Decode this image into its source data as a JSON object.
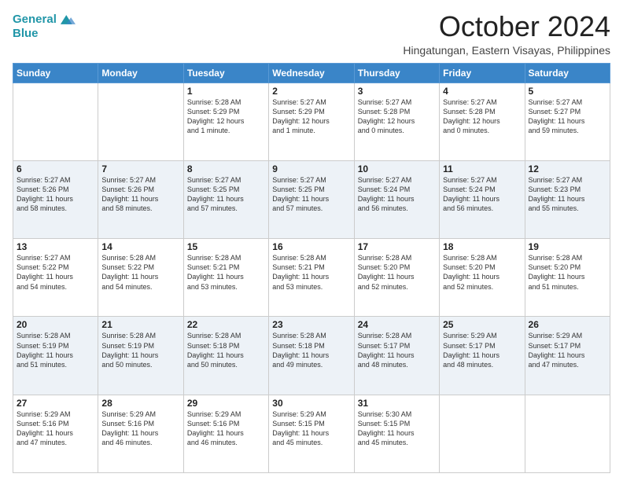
{
  "header": {
    "logo_line1": "General",
    "logo_line2": "Blue",
    "month_title": "October 2024",
    "location": "Hingatungan, Eastern Visayas, Philippines"
  },
  "days_of_week": [
    "Sunday",
    "Monday",
    "Tuesday",
    "Wednesday",
    "Thursday",
    "Friday",
    "Saturday"
  ],
  "weeks": [
    [
      {
        "day": "",
        "text": ""
      },
      {
        "day": "",
        "text": ""
      },
      {
        "day": "1",
        "text": "Sunrise: 5:28 AM\nSunset: 5:29 PM\nDaylight: 12 hours\nand 1 minute."
      },
      {
        "day": "2",
        "text": "Sunrise: 5:27 AM\nSunset: 5:29 PM\nDaylight: 12 hours\nand 1 minute."
      },
      {
        "day": "3",
        "text": "Sunrise: 5:27 AM\nSunset: 5:28 PM\nDaylight: 12 hours\nand 0 minutes."
      },
      {
        "day": "4",
        "text": "Sunrise: 5:27 AM\nSunset: 5:28 PM\nDaylight: 12 hours\nand 0 minutes."
      },
      {
        "day": "5",
        "text": "Sunrise: 5:27 AM\nSunset: 5:27 PM\nDaylight: 11 hours\nand 59 minutes."
      }
    ],
    [
      {
        "day": "6",
        "text": "Sunrise: 5:27 AM\nSunset: 5:26 PM\nDaylight: 11 hours\nand 58 minutes."
      },
      {
        "day": "7",
        "text": "Sunrise: 5:27 AM\nSunset: 5:26 PM\nDaylight: 11 hours\nand 58 minutes."
      },
      {
        "day": "8",
        "text": "Sunrise: 5:27 AM\nSunset: 5:25 PM\nDaylight: 11 hours\nand 57 minutes."
      },
      {
        "day": "9",
        "text": "Sunrise: 5:27 AM\nSunset: 5:25 PM\nDaylight: 11 hours\nand 57 minutes."
      },
      {
        "day": "10",
        "text": "Sunrise: 5:27 AM\nSunset: 5:24 PM\nDaylight: 11 hours\nand 56 minutes."
      },
      {
        "day": "11",
        "text": "Sunrise: 5:27 AM\nSunset: 5:24 PM\nDaylight: 11 hours\nand 56 minutes."
      },
      {
        "day": "12",
        "text": "Sunrise: 5:27 AM\nSunset: 5:23 PM\nDaylight: 11 hours\nand 55 minutes."
      }
    ],
    [
      {
        "day": "13",
        "text": "Sunrise: 5:27 AM\nSunset: 5:22 PM\nDaylight: 11 hours\nand 54 minutes."
      },
      {
        "day": "14",
        "text": "Sunrise: 5:28 AM\nSunset: 5:22 PM\nDaylight: 11 hours\nand 54 minutes."
      },
      {
        "day": "15",
        "text": "Sunrise: 5:28 AM\nSunset: 5:21 PM\nDaylight: 11 hours\nand 53 minutes."
      },
      {
        "day": "16",
        "text": "Sunrise: 5:28 AM\nSunset: 5:21 PM\nDaylight: 11 hours\nand 53 minutes."
      },
      {
        "day": "17",
        "text": "Sunrise: 5:28 AM\nSunset: 5:20 PM\nDaylight: 11 hours\nand 52 minutes."
      },
      {
        "day": "18",
        "text": "Sunrise: 5:28 AM\nSunset: 5:20 PM\nDaylight: 11 hours\nand 52 minutes."
      },
      {
        "day": "19",
        "text": "Sunrise: 5:28 AM\nSunset: 5:20 PM\nDaylight: 11 hours\nand 51 minutes."
      }
    ],
    [
      {
        "day": "20",
        "text": "Sunrise: 5:28 AM\nSunset: 5:19 PM\nDaylight: 11 hours\nand 51 minutes."
      },
      {
        "day": "21",
        "text": "Sunrise: 5:28 AM\nSunset: 5:19 PM\nDaylight: 11 hours\nand 50 minutes."
      },
      {
        "day": "22",
        "text": "Sunrise: 5:28 AM\nSunset: 5:18 PM\nDaylight: 11 hours\nand 50 minutes."
      },
      {
        "day": "23",
        "text": "Sunrise: 5:28 AM\nSunset: 5:18 PM\nDaylight: 11 hours\nand 49 minutes."
      },
      {
        "day": "24",
        "text": "Sunrise: 5:28 AM\nSunset: 5:17 PM\nDaylight: 11 hours\nand 48 minutes."
      },
      {
        "day": "25",
        "text": "Sunrise: 5:29 AM\nSunset: 5:17 PM\nDaylight: 11 hours\nand 48 minutes."
      },
      {
        "day": "26",
        "text": "Sunrise: 5:29 AM\nSunset: 5:17 PM\nDaylight: 11 hours\nand 47 minutes."
      }
    ],
    [
      {
        "day": "27",
        "text": "Sunrise: 5:29 AM\nSunset: 5:16 PM\nDaylight: 11 hours\nand 47 minutes."
      },
      {
        "day": "28",
        "text": "Sunrise: 5:29 AM\nSunset: 5:16 PM\nDaylight: 11 hours\nand 46 minutes."
      },
      {
        "day": "29",
        "text": "Sunrise: 5:29 AM\nSunset: 5:16 PM\nDaylight: 11 hours\nand 46 minutes."
      },
      {
        "day": "30",
        "text": "Sunrise: 5:29 AM\nSunset: 5:15 PM\nDaylight: 11 hours\nand 45 minutes."
      },
      {
        "day": "31",
        "text": "Sunrise: 5:30 AM\nSunset: 5:15 PM\nDaylight: 11 hours\nand 45 minutes."
      },
      {
        "day": "",
        "text": ""
      },
      {
        "day": "",
        "text": ""
      }
    ]
  ]
}
